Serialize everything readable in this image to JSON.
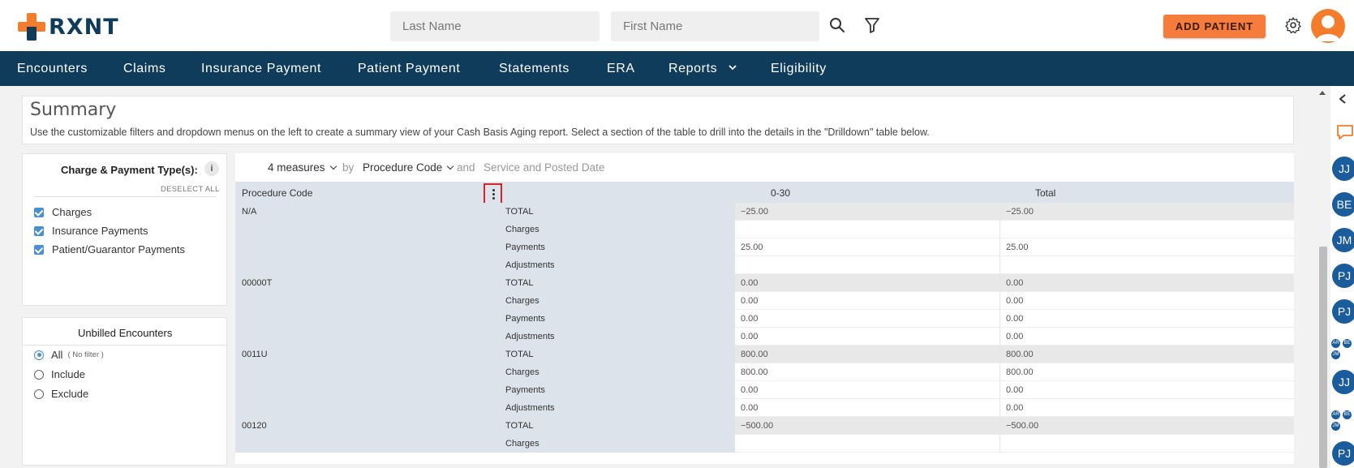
{
  "header": {
    "logo_text": "RXNT",
    "last_name_placeholder": "Last Name",
    "first_name_placeholder": "First Name",
    "add_patient_label": "ADD PATIENT"
  },
  "nav": {
    "items": [
      "Encounters",
      "Claims",
      "Insurance Payment",
      "Patient Payment",
      "Statements",
      "ERA",
      "Reports",
      "Eligibility"
    ]
  },
  "summary": {
    "title": "Summary",
    "description": "Use the customizable filters and dropdown menus on the left to create a summary view of your Cash Basis Aging report. Select a section of the table to drill into the details in the \"Drilldown\" table below."
  },
  "filters": {
    "charge_payment": {
      "title": "Charge & Payment Type(s):",
      "deselect_all": "DESELECT ALL",
      "options": [
        "Charges",
        "Insurance Payments",
        "Patient/Guarantor Payments"
      ]
    },
    "unbilled": {
      "title": "Unbilled Encounters",
      "options": [
        {
          "label": "All",
          "hint": "( No filter )",
          "selected": true
        },
        {
          "label": "Include",
          "hint": "",
          "selected": false
        },
        {
          "label": "Exclude",
          "hint": "",
          "selected": false
        }
      ]
    }
  },
  "pivot": {
    "measures_label": "4 measures",
    "by_label": "by",
    "group_by": "Procedure Code",
    "and_label": "and",
    "secondary_group": "Service and Posted Date",
    "columns": [
      "Procedure Code",
      "0-30",
      "Total"
    ],
    "groups": [
      {
        "code": "N/A",
        "rows": [
          {
            "measure": "TOTAL",
            "v0_30": "−25.00",
            "total": "−25.00"
          },
          {
            "measure": "Charges",
            "v0_30": "",
            "total": ""
          },
          {
            "measure": "Payments",
            "v0_30": "25.00",
            "total": "25.00"
          },
          {
            "measure": "Adjustments",
            "v0_30": "",
            "total": ""
          }
        ]
      },
      {
        "code": "00000T",
        "rows": [
          {
            "measure": "TOTAL",
            "v0_30": "0.00",
            "total": "0.00"
          },
          {
            "measure": "Charges",
            "v0_30": "0.00",
            "total": "0.00"
          },
          {
            "measure": "Payments",
            "v0_30": "0.00",
            "total": "0.00"
          },
          {
            "measure": "Adjustments",
            "v0_30": "0.00",
            "total": "0.00"
          }
        ]
      },
      {
        "code": "0011U",
        "rows": [
          {
            "measure": "TOTAL",
            "v0_30": "800.00",
            "total": "800.00"
          },
          {
            "measure": "Charges",
            "v0_30": "800.00",
            "total": "800.00"
          },
          {
            "measure": "Payments",
            "v0_30": "0.00",
            "total": "0.00"
          },
          {
            "measure": "Adjustments",
            "v0_30": "0.00",
            "total": "0.00"
          }
        ]
      },
      {
        "code": "00120",
        "rows": [
          {
            "measure": "TOTAL",
            "v0_30": "−500.00",
            "total": "−500.00"
          },
          {
            "measure": "Charges",
            "v0_30": "",
            "total": ""
          }
        ]
      }
    ]
  },
  "right_rail": {
    "users": [
      "JJ",
      "BE",
      "JM",
      "PJ",
      "PJ",
      "JJ",
      "PJ"
    ],
    "mini_groups": [
      [
        "AR",
        "BE",
        "JM"
      ],
      [
        "AR",
        "BE",
        "JM"
      ]
    ]
  },
  "colors": {
    "brand_orange": "#f57c2a",
    "nav_blue": "#0f3c5a",
    "highlight_red": "#d7232a"
  }
}
